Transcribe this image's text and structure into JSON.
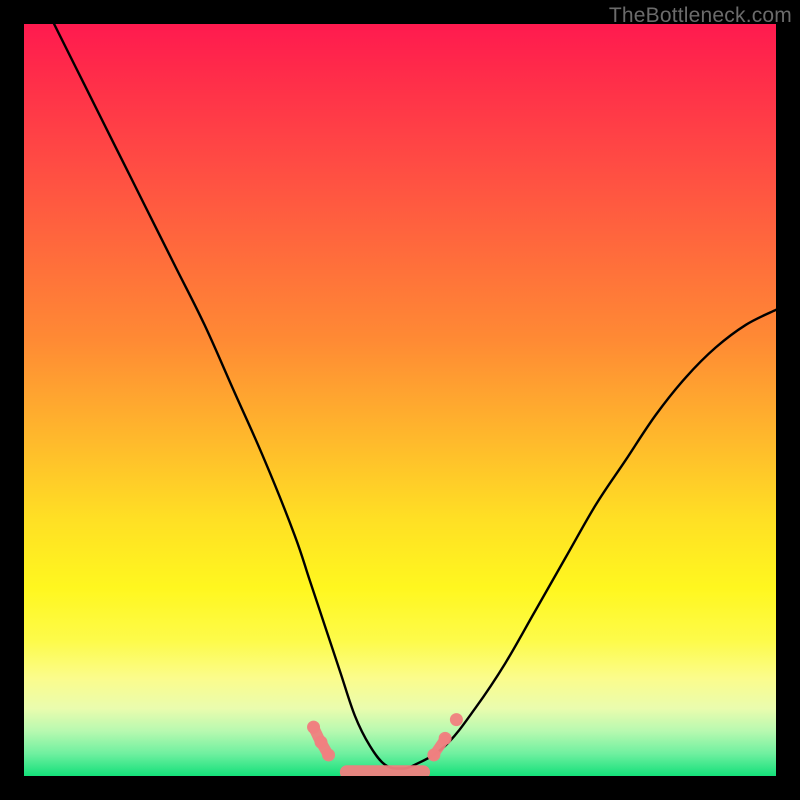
{
  "watermark": "TheBottleneck.com",
  "colors": {
    "frame": "#000000",
    "gradient_top": "#ff1a4f",
    "gradient_mid": "#ffe024",
    "gradient_bottom": "#14e07a",
    "curve_stroke": "#000000",
    "overlay_pink": "#f08080"
  },
  "chart_data": {
    "type": "line",
    "title": "",
    "xlabel": "",
    "ylabel": "",
    "xlim": [
      0,
      100
    ],
    "ylim": [
      0,
      100
    ],
    "grid": false,
    "series": [
      {
        "name": "bottleneck-curve",
        "x": [
          4,
          8,
          12,
          16,
          20,
          24,
          28,
          32,
          36,
          38,
          40,
          42,
          44,
          46,
          48,
          50,
          52,
          56,
          60,
          64,
          68,
          72,
          76,
          80,
          84,
          88,
          92,
          96,
          100
        ],
        "y": [
          100,
          92,
          84,
          76,
          68,
          60,
          51,
          42,
          32,
          26,
          20,
          14,
          8,
          4,
          1.5,
          1,
          1.5,
          4,
          9,
          15,
          22,
          29,
          36,
          42,
          48,
          53,
          57,
          60,
          62
        ]
      }
    ],
    "annotations": [
      {
        "name": "valley-floor-overlay",
        "kind": "segment",
        "x_range": [
          42,
          54
        ],
        "y": 0.5,
        "style": "pink-rounded"
      },
      {
        "name": "valley-left-nodes",
        "kind": "points",
        "x": [
          38.5,
          39.5,
          40.5
        ],
        "y": [
          6.5,
          4.5,
          2.8
        ],
        "style": "pink-dot"
      },
      {
        "name": "valley-right-nodes",
        "kind": "points",
        "x": [
          54.5,
          56.0,
          57.5
        ],
        "y": [
          2.8,
          5.0,
          7.5
        ],
        "style": "pink-dot"
      }
    ]
  }
}
